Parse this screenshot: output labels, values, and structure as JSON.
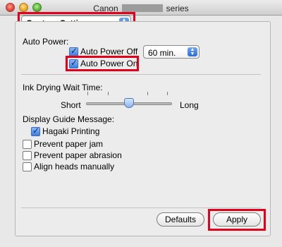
{
  "window": {
    "title_prefix": "Canon",
    "title_suffix": "series"
  },
  "settings_popup": {
    "value": "Custom Settings"
  },
  "auto_power": {
    "heading": "Auto Power:",
    "off_label": "Auto Power Off",
    "off_checked": true,
    "off_time": "60 min.",
    "on_label": "Auto Power On",
    "on_checked": true
  },
  "ink_drying": {
    "heading": "Ink Drying Wait Time:",
    "min_label": "Short",
    "max_label": "Long",
    "level_fraction": 0.5
  },
  "guide": {
    "heading": "Display Guide Message:",
    "hagaki_label": "Hagaki Printing",
    "hagaki_checked": true
  },
  "options": [
    {
      "label": "Prevent paper jam",
      "checked": false
    },
    {
      "label": "Prevent paper abrasion",
      "checked": false
    },
    {
      "label": "Align heads manually",
      "checked": false
    }
  ],
  "buttons": {
    "defaults": "Defaults",
    "apply": "Apply"
  },
  "icons": {
    "checkmark": "check-icon",
    "stepper": "popup-arrows-icon"
  },
  "colors": {
    "highlight": "#e2001a",
    "accent": "#3c7de0"
  }
}
